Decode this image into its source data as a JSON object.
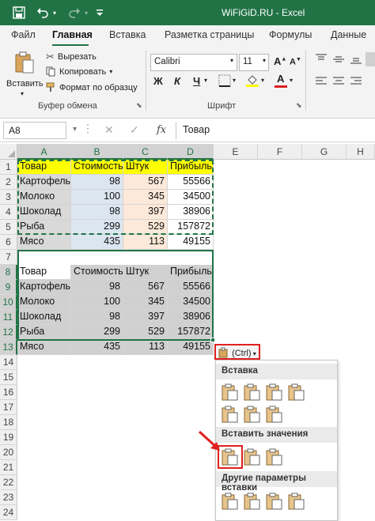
{
  "titlebar": {
    "title": "WiFiGiD.RU  -  Excel"
  },
  "tabs": [
    {
      "label": "Файл"
    },
    {
      "label": "Главная"
    },
    {
      "label": "Вставка"
    },
    {
      "label": "Разметка страницы"
    },
    {
      "label": "Формулы"
    },
    {
      "label": "Данные"
    }
  ],
  "ribbon": {
    "paste_label": "Вставить",
    "cut_label": "Вырезать",
    "copy_label": "Копировать",
    "format_painter_label": "Формат по образцу",
    "clipboard_group": "Буфер обмена",
    "font_name": "Calibri",
    "font_size": "11",
    "font_group": "Шрифт",
    "bold": "Ж",
    "italic": "К",
    "underline": "Ч"
  },
  "formula_bar": {
    "name_box": "A8",
    "fx": "fx",
    "value": "Товар"
  },
  "columns": [
    "A",
    "B",
    "C",
    "D",
    "E",
    "F",
    "G",
    "H"
  ],
  "rows": [
    "1",
    "2",
    "3",
    "4",
    "5",
    "6",
    "7",
    "8",
    "9",
    "10",
    "11",
    "12",
    "13",
    "14",
    "15",
    "16",
    "17",
    "18",
    "19",
    "20",
    "21",
    "22",
    "23",
    "24"
  ],
  "table1": {
    "headers": [
      "Товар",
      "Стоимость",
      "Штук",
      "Прибыль"
    ],
    "rows": [
      [
        "Картофель",
        "98",
        "567",
        "55566"
      ],
      [
        "Молоко",
        "100",
        "345",
        "34500"
      ],
      [
        "Шоколад",
        "98",
        "397",
        "38906"
      ],
      [
        "Рыба",
        "299",
        "529",
        "157872"
      ],
      [
        "Мясо",
        "435",
        "113",
        "49155"
      ]
    ]
  },
  "table2": {
    "headers": [
      "Товар",
      "Стоимость",
      "Штук",
      "Прибыль"
    ],
    "rows": [
      [
        "Картофель",
        "98",
        "567",
        "55566"
      ],
      [
        "Молоко",
        "100",
        "345",
        "34500"
      ],
      [
        "Шоколад",
        "98",
        "397",
        "38906"
      ],
      [
        "Рыба",
        "299",
        "529",
        "157872"
      ],
      [
        "Мясо",
        "435",
        "113",
        "49155"
      ]
    ]
  },
  "paste_options": {
    "button_label": "(Ctrl)",
    "section_paste": "Вставка",
    "section_values": "Вставить значения",
    "section_other": "Другие параметры вставки"
  },
  "colors": {
    "excel_green": "#217346",
    "highlight_red": "#e02020",
    "yellow": "#ffff00"
  }
}
